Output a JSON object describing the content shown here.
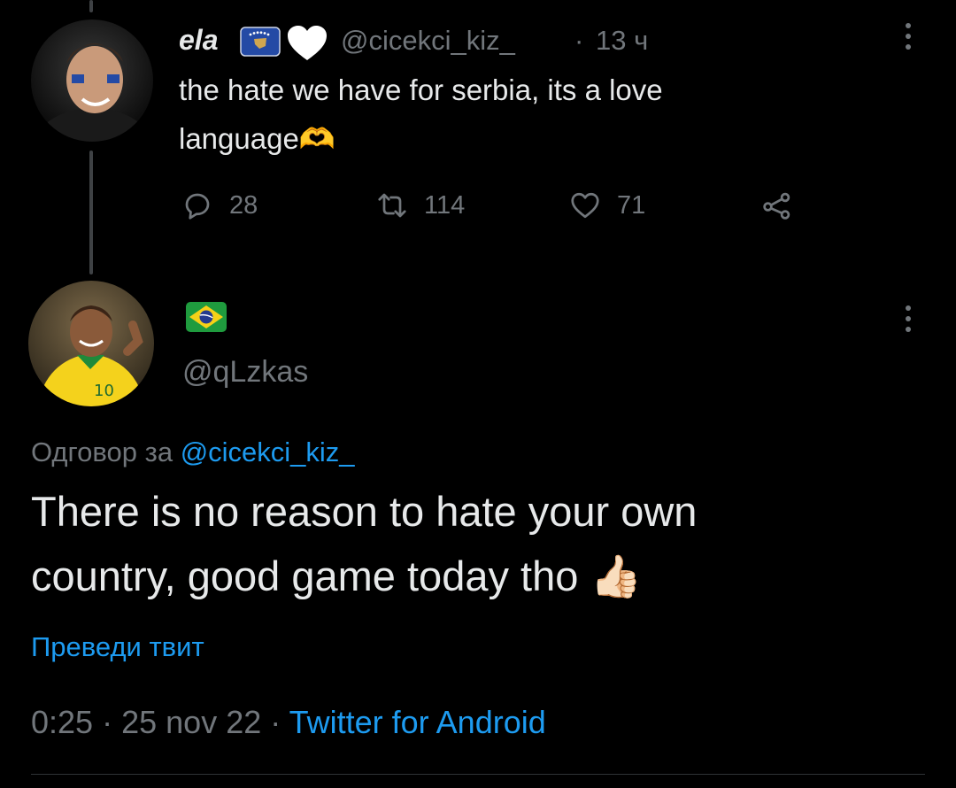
{
  "parent_tweet": {
    "display_name": "ela",
    "handle": "@cicekci_kiz_",
    "separator": "·",
    "time": "13 ч",
    "text_line1": "the hate we have for serbia, its a love",
    "text_line2": "language",
    "text_emoji": "🫶",
    "actions": {
      "reply_count": "28",
      "retweet_count": "114",
      "like_count": "71"
    },
    "icons": [
      "kosovo-flag-icon",
      "white-heart-icon",
      "more-icon",
      "reply-icon",
      "retweet-icon",
      "like-icon",
      "share-icon"
    ]
  },
  "main_tweet": {
    "display_name_flag": "brazil-flag",
    "handle": "@qLzkas",
    "reply_prefix": "Одговор за",
    "reply_to": "@cicekci_kiz_",
    "text_line1": "There is no reason to hate your own",
    "text_line2": "country, good game today tho",
    "text_emoji": "👍🏻",
    "translate_label": "Преведи твит",
    "meta_time": "0:25",
    "meta_sep1": "·",
    "meta_date": "25 nov 22",
    "meta_sep2": "·",
    "meta_source": "Twitter for Android"
  },
  "colors": {
    "background": "#000000",
    "text": "#e7e9ea",
    "muted": "#71767b",
    "link": "#1d9bf0",
    "thread_line": "#3e4144"
  }
}
